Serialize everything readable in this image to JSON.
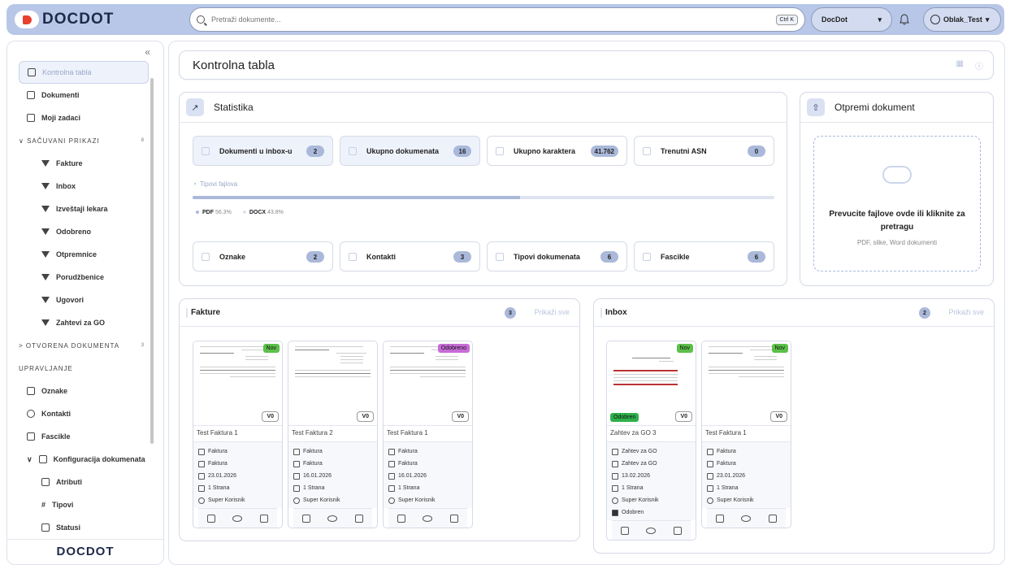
{
  "brand": {
    "logo_text": "DOCDOT"
  },
  "topbar": {
    "search_placeholder": "Pretraži dokumente...",
    "search_shortcut": "Ctrl K",
    "workspace": "DocDot",
    "user": "Oblak_Test"
  },
  "sidebar": {
    "items": [
      {
        "label": "Kontrolna tabla",
        "icon": "home-icon"
      },
      {
        "label": "Dokumenti",
        "icon": "document-icon"
      },
      {
        "label": "Moji zadaci",
        "icon": "list-icon"
      }
    ],
    "saved_views": {
      "label": "SAČUVANI PRIKAZI",
      "count": "8",
      "items": [
        "Fakture",
        "Inbox",
        "Izveštaji lekara",
        "Odobreno",
        "Otpremnice",
        "Porudžbenice",
        "Ugovori",
        "Zahtevi za GO"
      ]
    },
    "open_docs": {
      "label": "OTVORENA DOKUMENTA",
      "count": "3"
    },
    "management": {
      "label": "UPRAVLJANJE",
      "items": [
        "Oznake",
        "Kontakti",
        "Fascikle",
        "Konfiguracija dokumenata"
      ],
      "config_items": [
        "Atributi",
        "Tipovi",
        "Statusi"
      ]
    }
  },
  "page": {
    "title": "Kontrolna tabla"
  },
  "stats": {
    "title": "Statistika",
    "boxes": [
      {
        "label": "Dokumenti u inbox-u",
        "value": "2"
      },
      {
        "label": "Ukupno dokumenata",
        "value": "16"
      },
      {
        "label": "Ukupno karaktera",
        "value": "41.762"
      },
      {
        "label": "Trenutni ASN",
        "value": "0"
      }
    ],
    "file_types_label": "Tipovi fajlova",
    "file_types": [
      {
        "name": "PDF",
        "percent": "56.3%",
        "fraction": 0.563
      },
      {
        "name": "DOCX",
        "percent": "43.8%",
        "fraction": 0.438
      }
    ],
    "bottom_boxes": [
      {
        "label": "Oznake",
        "value": "2"
      },
      {
        "label": "Kontakti",
        "value": "3"
      },
      {
        "label": "Tipovi dokumenata",
        "value": "6"
      },
      {
        "label": "Fascikle",
        "value": "6"
      }
    ]
  },
  "upload": {
    "title": "Otpremi dokument",
    "drop_text": "Prevucite fajlove ovde ili kliknite za pretragu",
    "drop_sub": "PDF, slike, Word dokumenti"
  },
  "fakture": {
    "title": "Fakture",
    "count": "3",
    "show_all": "Prikaži sve",
    "docs": [
      {
        "tag": "Nov",
        "version": "V0",
        "title": "Test Faktura 1",
        "type": "Faktura",
        "folder": "Faktura",
        "date": "23.01.2026",
        "pages": "1 Strana",
        "owner": "Super Korisnik"
      },
      {
        "tag": "",
        "version": "V0",
        "title": "Test Faktura 2",
        "type": "Faktura",
        "folder": "Faktura",
        "date": "16.01.2026",
        "pages": "1 Strana",
        "owner": "Super Korisnik"
      },
      {
        "tag": "Odobreno",
        "version": "V0",
        "title": "Test Faktura 1",
        "type": "Faktura",
        "folder": "Faktura",
        "date": "16.01.2026",
        "pages": "1 Strana",
        "owner": "Super Korisnik"
      }
    ]
  },
  "inbox": {
    "title": "Inbox",
    "count": "2",
    "show_all": "Prikaži sve",
    "docs": [
      {
        "tag": "Nov",
        "status_tag": "Odobren",
        "version": "V0",
        "title": "Zahtev za GO 3",
        "type": "Zahtev za GO",
        "folder": "Zahtev za GO",
        "date": "13.02.2026",
        "pages": "1 Strana",
        "owner": "Super Korisnik",
        "status": "Odobren"
      },
      {
        "tag": "Nov",
        "version": "V0",
        "title": "Test Faktura 1",
        "type": "Faktura",
        "folder": "Faktura",
        "date": "23.01.2026",
        "pages": "1 Strana",
        "owner": "Super Korisnik"
      }
    ]
  },
  "colors": {
    "accent": "#b8c7e8",
    "pill": "#aab9da",
    "tag_new": "#5cc04a",
    "tag_approved": "#c76bd6",
    "status_approved": "#2fb04b",
    "brand_red": "#e8412f"
  }
}
